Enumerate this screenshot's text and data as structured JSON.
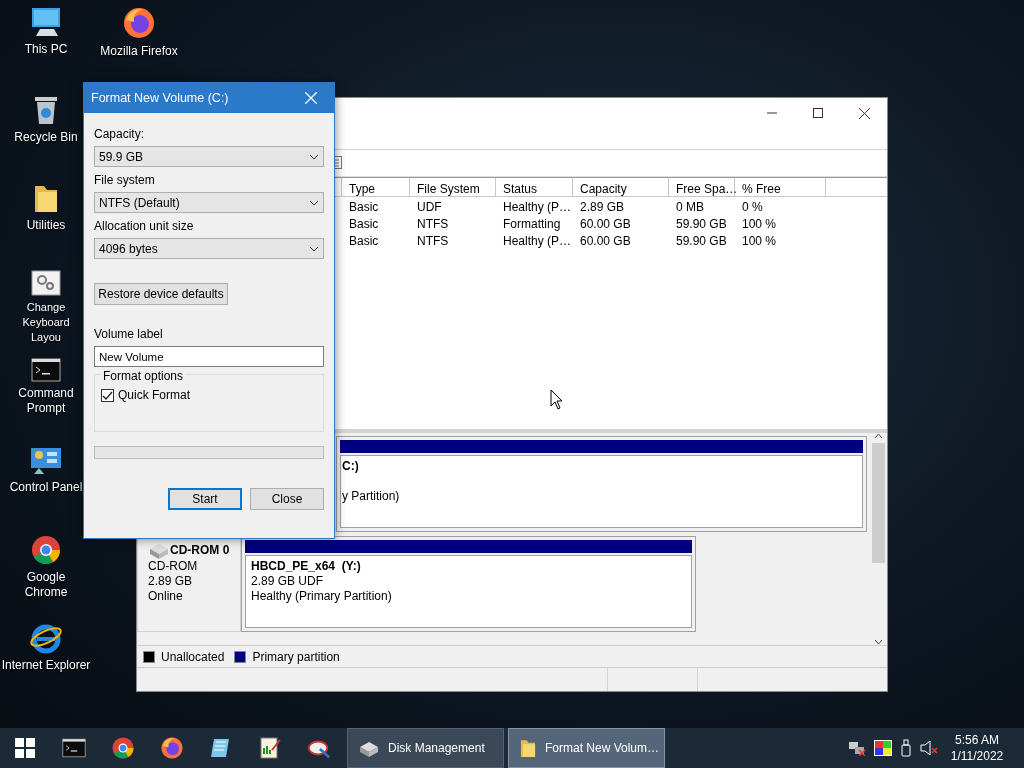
{
  "desktop_icons": [
    {
      "label": "This PC",
      "kind": "pc"
    },
    {
      "label": "Mozilla Firefox",
      "kind": "firefox"
    },
    {
      "label": "Recycle Bin",
      "kind": "bin"
    },
    {
      "label": "Utilities",
      "kind": "folder"
    },
    {
      "label": "Change Keyboard Layou",
      "kind": "settings"
    },
    {
      "label": "Command Prompt",
      "kind": "cmd"
    },
    {
      "label": "Control Panel",
      "kind": "panel"
    },
    {
      "label": "Google Chrome",
      "kind": "chrome"
    },
    {
      "label": "Internet Explorer",
      "kind": "ie"
    }
  ],
  "disk_management": {
    "table": {
      "columns": [
        "Type",
        "File System",
        "Status",
        "Capacity",
        "Free Spa…",
        "% Free"
      ],
      "rows": [
        [
          "Basic",
          "UDF",
          "Healthy (P…",
          "2.89 GB",
          "0 MB",
          "0 %"
        ],
        [
          "Basic",
          "NTFS",
          "Formatting",
          "60.00 GB",
          "59.90 GB",
          "100 %"
        ],
        [
          "Basic",
          "NTFS",
          "Healthy (P…",
          "60.00 GB",
          "59.90 GB",
          "100 %"
        ]
      ]
    },
    "disks": [
      {
        "partition": {
          "name": "C:)",
          "lines": [
            "y Partition)"
          ]
        }
      },
      {
        "name": "CD-ROM 0",
        "lines": [
          "CD-ROM",
          "2.89 GB",
          "Online"
        ],
        "partition": {
          "name": "HBCD_PE_x64  (Y:)",
          "lines": [
            "2.89 GB UDF",
            "Healthy (Primary Partition)"
          ]
        }
      }
    ],
    "legend": [
      {
        "label": "Unallocated",
        "color": "#000000"
      },
      {
        "label": "Primary partition",
        "color": "#000080"
      }
    ]
  },
  "dialog": {
    "title": "Format New Volume (C:)",
    "selects": [
      {
        "label": "Capacity:",
        "value": "59.9 GB"
      },
      {
        "label": "File system",
        "value": "NTFS (Default)"
      },
      {
        "label": "Allocation unit size",
        "value": "4096 bytes"
      }
    ],
    "restore_button": "Restore device defaults",
    "volume_label": {
      "label": "Volume label",
      "value": "New Volume"
    },
    "format_options": {
      "title": "Format options",
      "quick_format": {
        "label": "Quick Format",
        "checked": true
      }
    },
    "progress": {
      "level": 0
    },
    "buttons": [
      {
        "label": "Start",
        "default": true
      },
      {
        "label": "Close",
        "default": false
      }
    ]
  },
  "taskbar": {
    "pinned": [
      {
        "kind": "cmd"
      },
      {
        "kind": "chrome"
      },
      {
        "kind": "firefox"
      },
      {
        "kind": "notepad"
      },
      {
        "kind": "editor"
      },
      {
        "kind": "tool"
      }
    ],
    "windows": [
      {
        "label": "Disk Management",
        "kind": "disk",
        "selected": false
      },
      {
        "label": "Format New Volum…",
        "kind": "folder",
        "selected": true
      }
    ],
    "time": "5:56 AM",
    "date": "1/11/2022"
  }
}
